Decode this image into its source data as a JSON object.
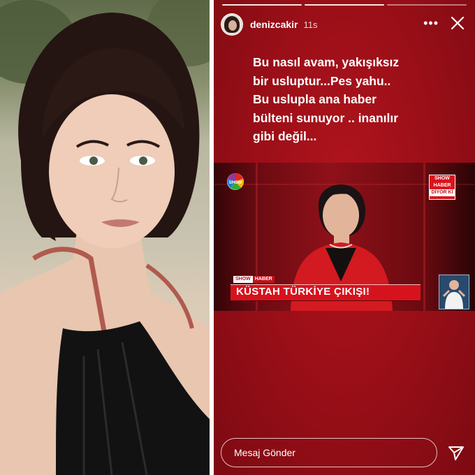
{
  "story": {
    "username": "denizcakir",
    "time": "11s",
    "more_icon": "more-options-icon",
    "close_icon": "close-icon",
    "progress_segments": 3,
    "caption_lines": [
      "Bu nasıl avam, yakışıksız",
      "bir usluptur...Pes yahu..",
      "Bu uslupla ana haber",
      "bülteni sunuyor .. inanılır",
      "gibi değil..."
    ],
    "tv": {
      "channel_logo": "SHOW",
      "corner_logo_line1": "SHOW",
      "corner_logo_line2": "HABER",
      "corner_logo_line3": "DİYOR Kİ",
      "tag_show": "SHOW",
      "tag_haber": "HABER",
      "headline": "KÜSTAH TÜRKİYE ÇIKIŞI!"
    },
    "message_placeholder": "Mesaj Gönder",
    "send_icon": "send-icon"
  },
  "colors": {
    "story_background": "#9c0f18",
    "headline_bar": "#d6131d",
    "text": "#ffffff"
  }
}
